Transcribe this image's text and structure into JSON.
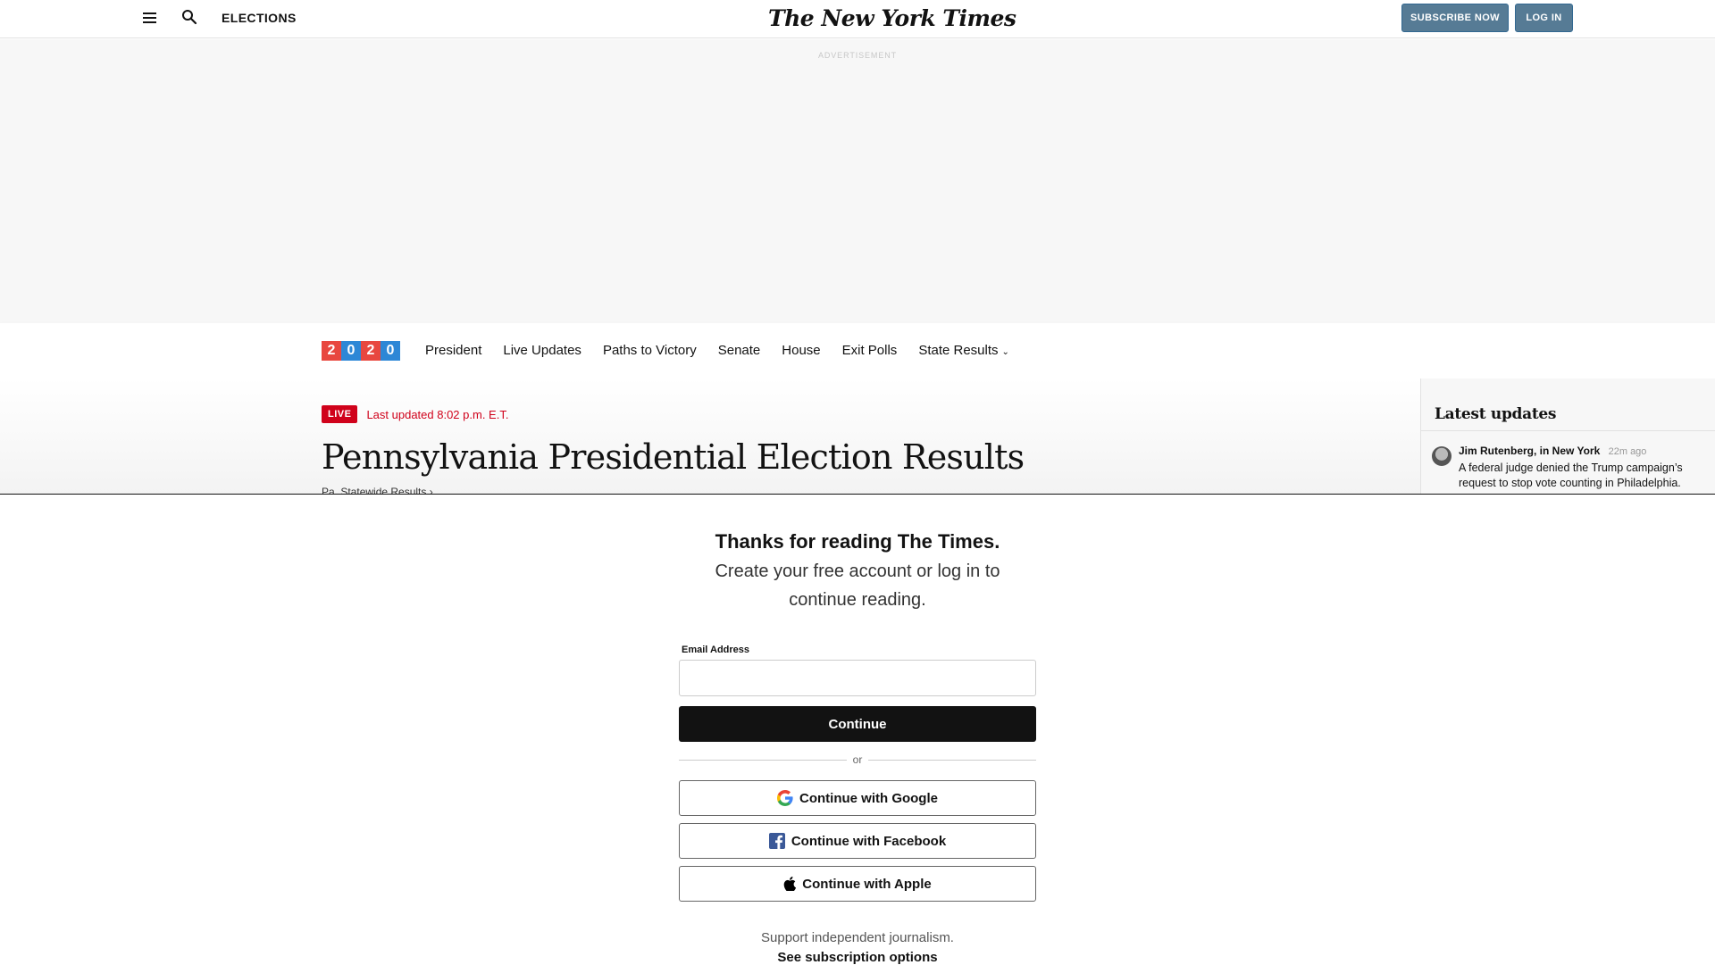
{
  "masthead": {
    "section": "ELECTIONS",
    "logo": "The New York Times",
    "subscribe_label": "SUBSCRIBE NOW",
    "login_label": "LOG IN"
  },
  "ad": {
    "label": "ADVERTISEMENT"
  },
  "election_nav": {
    "year_digits": [
      {
        "digit": "2",
        "color": "#e8473f"
      },
      {
        "digit": "0",
        "color": "#2d87d6"
      },
      {
        "digit": "2",
        "color": "#e8473f"
      },
      {
        "digit": "0",
        "color": "#2d87d6"
      }
    ],
    "items": [
      "President",
      "Live Updates",
      "Paths to Victory",
      "Senate",
      "House",
      "Exit Polls",
      "State Results"
    ],
    "dropdown_glyph": "⌄"
  },
  "article": {
    "live_label": "LIVE",
    "last_updated": "Last updated 8:02 p.m. E.T.",
    "headline": "Pennsylvania Presidential Election Results",
    "statewide_link": "Pa. Statewide Results ›"
  },
  "sidebar": {
    "title": "Latest updates",
    "entries": [
      {
        "author": "Jim Rutenberg, in New York",
        "time": "22m ago",
        "text": "A federal judge denied the Trump campaign’s request to stop vote counting in Philadelphia."
      }
    ]
  },
  "regwall": {
    "title": "Thanks for reading The Times.",
    "subtitle": "Create your free account or log in to continue reading.",
    "email_label": "Email Address",
    "email_value": "",
    "continue_label": "Continue",
    "or_label": "or",
    "google_label": "Continue with Google",
    "facebook_label": "Continue with Facebook",
    "apple_label": "Continue with Apple",
    "support_text": "Support independent journalism.",
    "see_subscription": "See subscription options"
  },
  "colors": {
    "live_red": "#d0021b",
    "button_blue": "#567b95",
    "facebook_blue": "#3b5998"
  }
}
